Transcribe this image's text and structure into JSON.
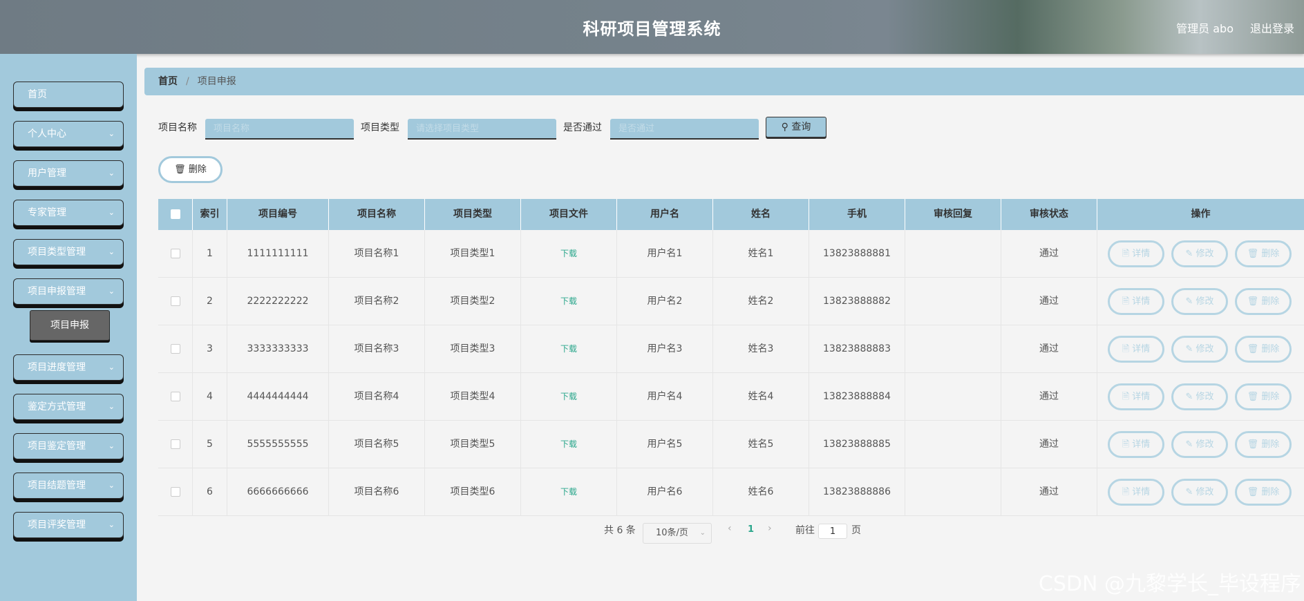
{
  "header": {
    "title": "科研项目管理系统",
    "user": "管理员 abo",
    "logout": "退出登录"
  },
  "sidebar": {
    "items": [
      {
        "label": "首页",
        "has_chevron": false
      },
      {
        "label": "个人中心",
        "has_chevron": true
      },
      {
        "label": "用户管理",
        "has_chevron": true
      },
      {
        "label": "专家管理",
        "has_chevron": true
      },
      {
        "label": "项目类型管理",
        "has_chevron": true
      },
      {
        "label": "项目申报管理",
        "has_chevron": true
      },
      {
        "label": "项目进度管理",
        "has_chevron": true
      },
      {
        "label": "鉴定方式管理",
        "has_chevron": true
      },
      {
        "label": "项目鉴定管理",
        "has_chevron": true
      },
      {
        "label": "项目结题管理",
        "has_chevron": true
      },
      {
        "label": "项目评奖管理",
        "has_chevron": true
      }
    ],
    "active_sub": "项目申报"
  },
  "breadcrumb": {
    "home": "首页",
    "current": "项目申报"
  },
  "search": {
    "name_label": "项目名称",
    "name_placeholder": "项目名称",
    "type_label": "项目类型",
    "type_placeholder": "请选择项目类型",
    "passed_label": "是否通过",
    "passed_placeholder": "是否通过",
    "query_label": "查询"
  },
  "actions": {
    "delete_label": "删除"
  },
  "table": {
    "columns": [
      "索引",
      "项目编号",
      "项目名称",
      "项目类型",
      "项目文件",
      "用户名",
      "姓名",
      "手机",
      "审核回复",
      "审核状态",
      "操作"
    ],
    "rows": [
      {
        "index": "1",
        "code": "1111111111",
        "name": "项目名称1",
        "type": "项目类型1",
        "file": "下载",
        "username": "用户名1",
        "realname": "姓名1",
        "phone": "13823888881",
        "reply": "",
        "status": "通过"
      },
      {
        "index": "2",
        "code": "2222222222",
        "name": "项目名称2",
        "type": "项目类型2",
        "file": "下载",
        "username": "用户名2",
        "realname": "姓名2",
        "phone": "13823888882",
        "reply": "",
        "status": "通过"
      },
      {
        "index": "3",
        "code": "3333333333",
        "name": "项目名称3",
        "type": "项目类型3",
        "file": "下载",
        "username": "用户名3",
        "realname": "姓名3",
        "phone": "13823888883",
        "reply": "",
        "status": "通过"
      },
      {
        "index": "4",
        "code": "4444444444",
        "name": "项目名称4",
        "type": "项目类型4",
        "file": "下载",
        "username": "用户名4",
        "realname": "姓名4",
        "phone": "13823888884",
        "reply": "",
        "status": "通过"
      },
      {
        "index": "5",
        "code": "5555555555",
        "name": "项目名称5",
        "type": "项目类型5",
        "file": "下载",
        "username": "用户名5",
        "realname": "姓名5",
        "phone": "13823888885",
        "reply": "",
        "status": "通过"
      },
      {
        "index": "6",
        "code": "6666666666",
        "name": "项目名称6",
        "type": "项目类型6",
        "file": "下载",
        "username": "用户名6",
        "realname": "姓名6",
        "phone": "13823888886",
        "reply": "",
        "status": "通过"
      }
    ],
    "row_actions": {
      "detail": "详情",
      "edit": "修改",
      "delete": "删除"
    }
  },
  "pagination": {
    "total": "共 6 条",
    "page_size": "10条/页",
    "prev": "‹",
    "current_page": "1",
    "next": "›",
    "goto_label": "前往",
    "goto_value": "1",
    "page_suffix": "页"
  },
  "watermark": "CSDN @九黎学长_毕设程序",
  "colors": {
    "accent": "#a2c9dc",
    "link": "#2aa68b",
    "submenu_active": "#666666"
  }
}
